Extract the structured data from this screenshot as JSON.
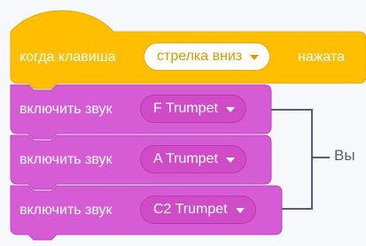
{
  "hat_block": {
    "prefix": "когда клавиша",
    "key_dropdown": "стрелка вниз",
    "suffix": "нажата"
  },
  "sound_blocks": [
    {
      "label": "включить звук",
      "sound": "F Trumpet"
    },
    {
      "label": "включить звук",
      "sound": "A Trumpet"
    },
    {
      "label": "включить звук",
      "sound": "C2 Trumpet"
    }
  ],
  "bracket_text": "Вы",
  "colors": {
    "events_fill": "#ffbf00",
    "events_stroke": "#e6a800",
    "sound_fill": "#d65cd6",
    "sound_stroke": "#bd42bd",
    "dropdown_fill": "#cf4bc7",
    "bracket_line": "#575e75"
  }
}
